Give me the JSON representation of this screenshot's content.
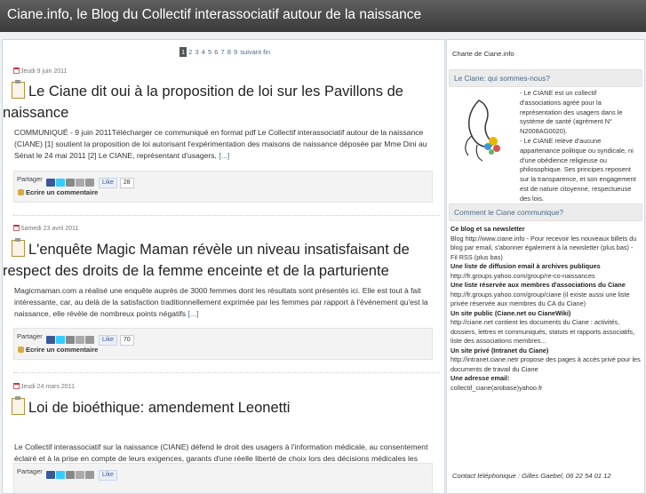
{
  "header": {
    "title": "Ciane.info, le Blog du Collectif interassociatif autour de la naissance"
  },
  "pager": {
    "current": "1",
    "pages": [
      "2",
      "3",
      "4",
      "5",
      "6",
      "7",
      "8",
      "9"
    ],
    "next": "suivant",
    "end": "fin"
  },
  "share": {
    "label": "Partager",
    "like": "Like",
    "comment": "Ecrire un commentaire",
    "more": "[...]"
  },
  "posts": [
    {
      "date": "Jeudi 9 juin 2011",
      "title": "Le Ciane dit oui à la proposition de loi sur les Pavillons de naissance",
      "excerpt": "COMMUNIQUÉ - 9 juin 2011Télécharger ce communiqué en format pdf Le Collectif interassociatif autour de la naissance (CIANE) [1] soutient la proposition de loi autorisant l'expérimentation des maisons de naissance déposée par Mme Dini au Sénat le 24 mai 2011 [2] Le CIANE, représentant d'usagers,",
      "likes": "28"
    },
    {
      "date": "Samedi 23 avril 2011",
      "title": "L'enquête Magic Maman révèle un niveau insatisfaisant de respect des droits de la femme enceinte et de la parturiente",
      "excerpt": "Magicmaman.com a réalisé une enquête auprès de 3000 femmes dont les résultats sont présentés ici. Elle est tout à fait intéressante, car, au delà de la satisfaction traditionnellement exprimée par les femmes par rapport à l'événement qu'est la naissance, elle révèle de nombreux points négatifs",
      "likes": "70"
    },
    {
      "date": "Jeudi 24 mars 2011",
      "title": "Loi de bioéthique: amendement Leonetti",
      "excerpt": "Le Collectif interassociatif sur la naissance (CIANE) défend le droit des usagers à l'information médicale, au consentement éclairé et à la prise en compte de leurs exigences, garants d'une réelle liberté de choix lors des décisions médicales les concernant personnellement dans le domaine de la",
      "likes": ""
    }
  ],
  "sidebar": {
    "charte": "Charte de Ciane.info",
    "box1": "Le Ciane: qui sommes-nous?",
    "about1": "- Le CIANE est un collectif d'associations agréé pour la représentation des usagers dans le système de santé (agrément N° N2008AG0020).",
    "about2": "- Le CIANE relève d'aucune appartenance politique ou syndicale, ni d'une obédience religieuse ou philosophique. Ses principes reposent sur la transparence, et son engagement est de nature citoyenne, respectueuse des lois.",
    "box2": "Comment le Ciane communique?",
    "items": [
      {
        "h": "Ce blog et sa newsletter",
        "t": "Blog http://www.ciane.info - Pour recevoir les nouveaux billets du blog par email, s'abonner également à la newsletter (plus bas) - Fil RSS (plus bas)"
      },
      {
        "h": "Une liste de diffusion email à archives publiques",
        "t": "http://fr.groups.yahoo.com/group/re-co-naissances"
      },
      {
        "h": "Une liste réservée aux membres d'associations du Ciane",
        "t": "http://fr.groups.yahoo.com/group/ciane (il existe aussi une liste privée réservée aux membres du CA du Ciane)"
      },
      {
        "h": "Un site public (Ciane.net ou CianeWiki)",
        "t": "http://ciane.net contient les documents du Ciane : activités, dossiers, lettres et communiqués, statuts et rapports associatifs, liste des associations membres..."
      },
      {
        "h": "Un site privé (Intranet du Ciane)",
        "t": "http://intranet.ciane.netr propose des pages à accès privé pour les documents de travail du Ciane"
      },
      {
        "h": "Une adresse email:",
        "t": "collectif_ciane(arobase)yahoo.fr"
      }
    ],
    "contact": "Contact téléphonique : Gilles Gaebel, 06 22 54 01 12"
  }
}
